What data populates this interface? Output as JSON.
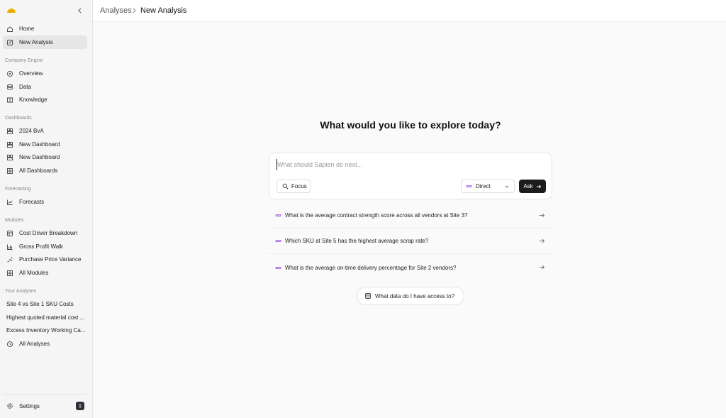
{
  "sidebar": {
    "logo_icon": "sapien-logo-icon",
    "collapse_icon": "chevron-left-icon",
    "top_items": [
      {
        "label": "Home",
        "icon": "home-icon"
      },
      {
        "label": "New Analysis",
        "icon": "edit-icon",
        "active": true
      }
    ],
    "sections": {
      "company_engine": {
        "title": "Company Engine",
        "items": [
          {
            "label": "Overview",
            "icon": "compass-icon"
          },
          {
            "label": "Data",
            "icon": "database-icon"
          },
          {
            "label": "Knowledge",
            "icon": "book-icon"
          }
        ]
      },
      "dashboards": {
        "title": "Dashboards",
        "items": [
          {
            "label": "2024 BvA",
            "icon": "dashboard-icon"
          },
          {
            "label": "New Dashboard",
            "icon": "dashboard-icon"
          },
          {
            "label": "New Dashboard",
            "icon": "dashboard-icon"
          },
          {
            "label": "All Dashboards",
            "icon": "grid-icon"
          }
        ]
      },
      "forecasting": {
        "title": "Forecasting",
        "items": [
          {
            "label": "Forecasts",
            "icon": "line-chart-icon"
          }
        ]
      },
      "modules": {
        "title": "Modules",
        "items": [
          {
            "label": "Cost Driver Breakdown",
            "icon": "layers-icon"
          },
          {
            "label": "Gross Profit Walk",
            "icon": "bar-chart-icon"
          },
          {
            "label": "Purchase Price Variance",
            "icon": "scatter-icon"
          },
          {
            "label": "All Modules",
            "icon": "grid-icon"
          }
        ]
      },
      "your_analyses": {
        "title": "Your Analyses",
        "items": [
          {
            "label": "Site 4 vs Site 1 SKU Costs"
          },
          {
            "label": "Highest quoted material cost ..."
          },
          {
            "label": "Excess Inventory Working Ca..."
          },
          {
            "label": "All Analyses",
            "icon": "clock-icon"
          }
        ]
      }
    },
    "settings_label": "Settings",
    "settings_icon": "gear-icon"
  },
  "header": {
    "breadcrumb_parent": "Analyses",
    "breadcrumb_current": "New Analysis"
  },
  "main": {
    "heading": "What would you like to explore today?",
    "prompt_placeholder": "What should Sapien do next...",
    "focus_label": "Focus",
    "mode_label": "Direct",
    "ask_label": "Ask",
    "suggestions": [
      "What is the average contract strength score across all vendors at Site 3?",
      "Which SKU at Site 5 has the highest average scrap rate?",
      "What is the average on-time delivery percentage for Site 2 vendors?"
    ],
    "access_label": "What data do I have access to?"
  },
  "colors": {
    "accent_purple": "#9b5de5",
    "logo_yellow": "#f2b705",
    "ask_button": "#1c1c1c"
  }
}
